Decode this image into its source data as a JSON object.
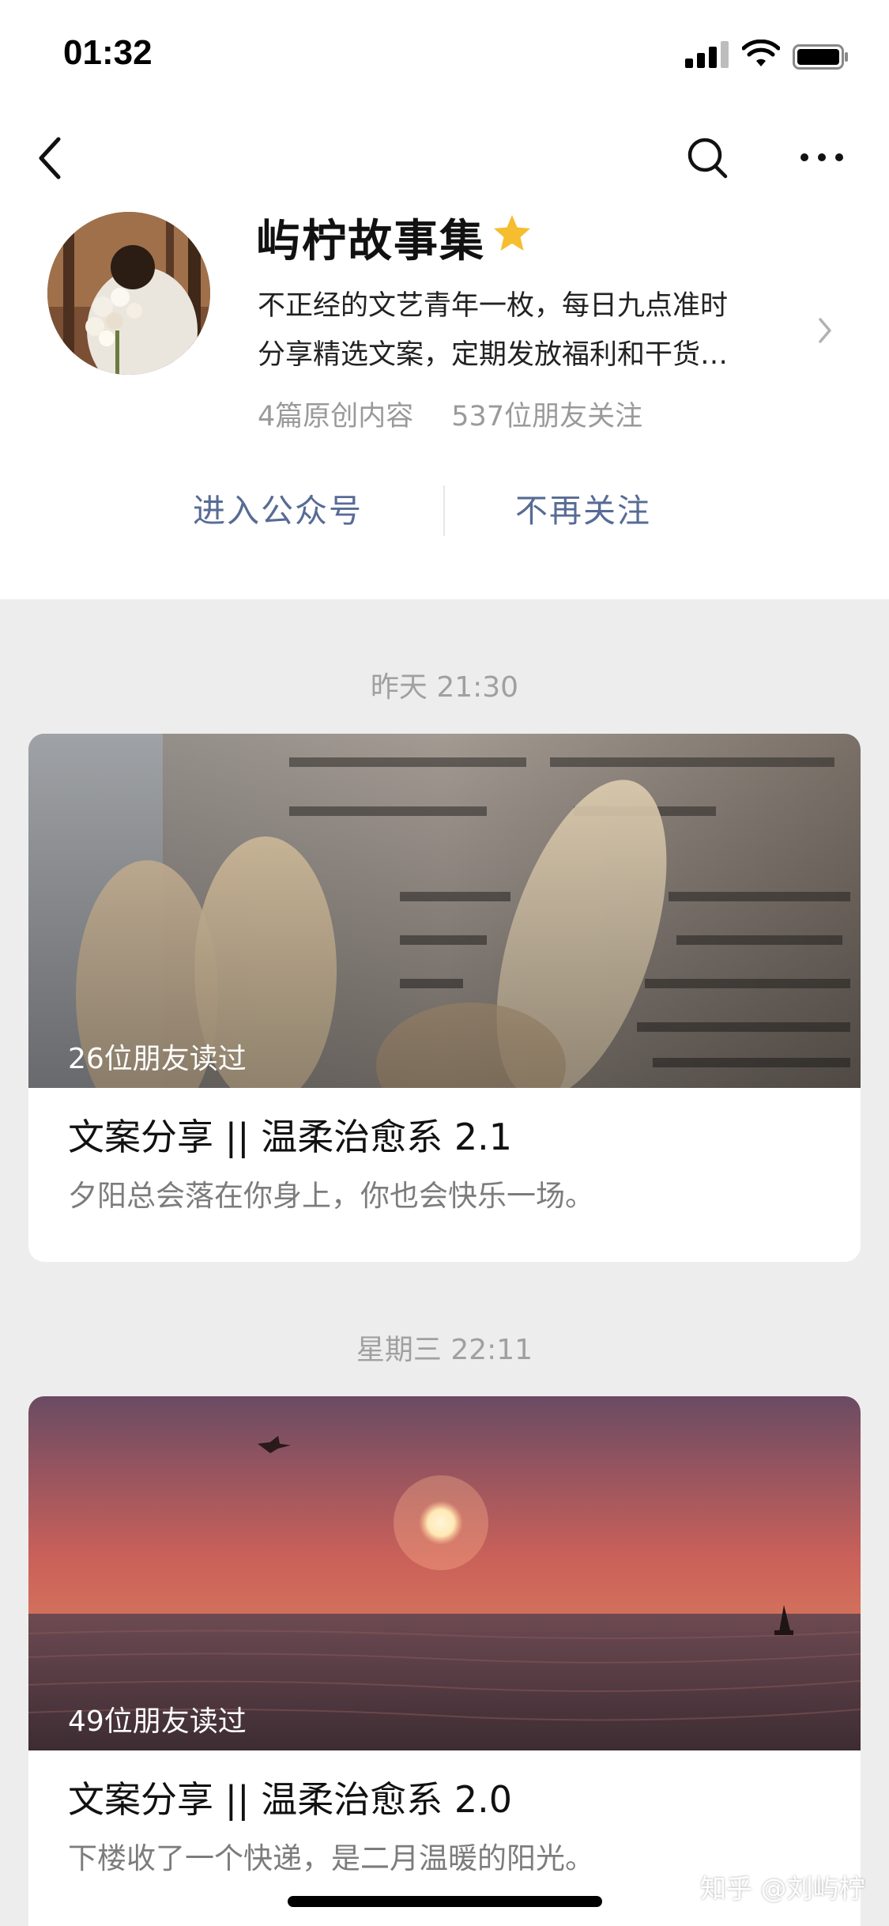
{
  "status_bar": {
    "time": "01:32"
  },
  "account": {
    "name": "屿柠故事集",
    "description_lines": [
      "不正经的文艺青年一枚，每日九点准时",
      "分享精选文案，定期发放福利和干货…"
    ],
    "original_count": "4篇原创内容",
    "followers": "537位朋友关注"
  },
  "actions": {
    "enter": "进入公众号",
    "unfollow": "不再关注"
  },
  "feed": [
    {
      "time": "昨天 21:30",
      "read_count": "26位朋友读过",
      "title": "文案分享 || 温柔治愈系 2.1",
      "subtitle": "夕阳总会落在你身上，你也会快乐一场。"
    },
    {
      "time": "星期三 22:11",
      "read_count": "49位朋友读过",
      "title": "文案分享 || 温柔治愈系 2.0",
      "subtitle": "下楼收了一个快递，是二月温暖的阳光。"
    }
  ],
  "watermark": "知乎 @刘屿柠",
  "colors": {
    "link": "#576b95",
    "star": "#f5bd2f",
    "background": "#ededed"
  },
  "icons": [
    "back-icon",
    "search-icon",
    "more-icon",
    "star-icon",
    "chevron-right-icon"
  ]
}
